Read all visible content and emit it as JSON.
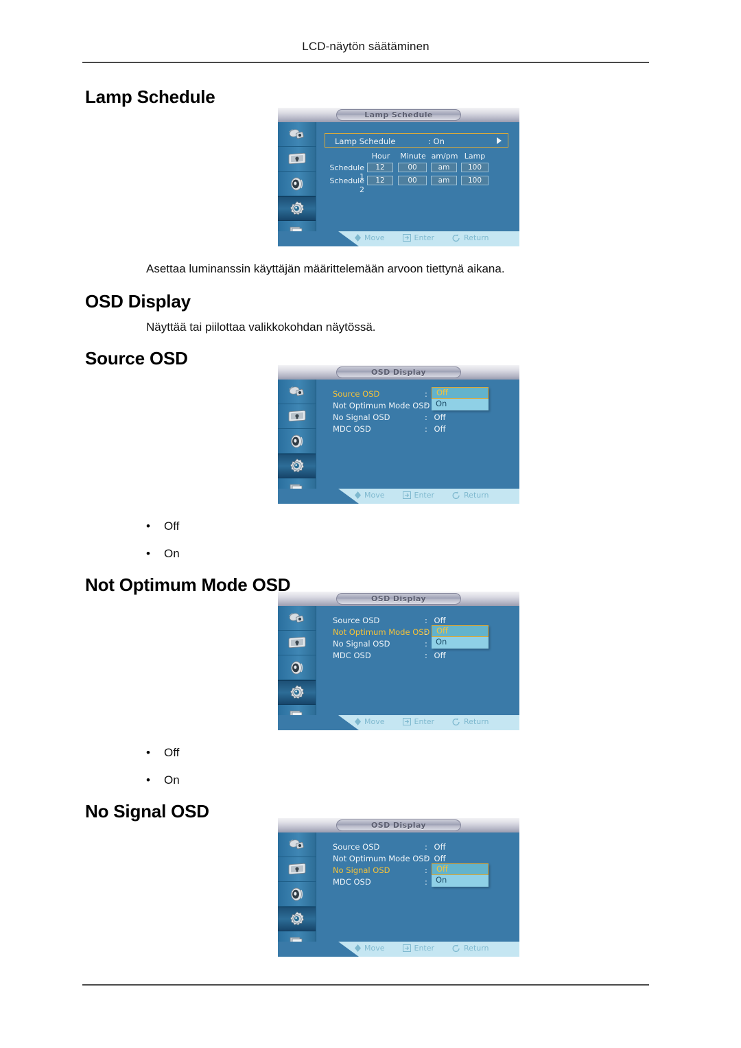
{
  "page": {
    "running_header": "LCD-näytön säätäminen"
  },
  "sections": [
    {
      "heading": "Lamp Schedule",
      "body": "Asettaa luminanssin käyttäjän määrittelemään arvoon tiettynä aikana."
    },
    {
      "heading": "OSD Display",
      "body": "Näyttää tai piilottaa valikkokohdan näytössä."
    },
    {
      "heading": "Source OSD"
    },
    {
      "heading": "Not Optimum Mode OSD"
    },
    {
      "heading": "No Signal OSD"
    }
  ],
  "bullets": {
    "off": "Off",
    "on": "On",
    "marker": "•"
  },
  "osd_common": {
    "footer": {
      "move": "Move",
      "enter": "Enter",
      "return": "Return"
    },
    "sidebar_icons": [
      "input-source-icon",
      "picture-icon",
      "sound-icon",
      "setup-gear-icon",
      "multi-control-icon"
    ],
    "colors": {
      "panel_bg": "#3a7aa8",
      "sidebar_bg": "#3f86b4",
      "footer_bg": "#c5e6f2",
      "highlight_text": "#f5c33a",
      "highlight_border": "#d7a93c",
      "dropdown_selected_bg": "#63b3cc",
      "dropdown_item_bg": "#8fd0e6",
      "text": "#eef4f8"
    }
  },
  "osd_lamp_schedule": {
    "title": "Lamp Schedule",
    "main_row": {
      "label": "Lamp Schedule",
      "value": ": On",
      "arrow": "play-arrow-icon"
    },
    "table": {
      "headers": [
        "Hour",
        "Minute",
        "am/pm",
        "Lamp"
      ],
      "rows": [
        {
          "name": "Schedule 1",
          "values": [
            "12",
            "00",
            "am",
            "100"
          ]
        },
        {
          "name": "Schedule 2",
          "values": [
            "12",
            "00",
            "am",
            "100"
          ]
        }
      ]
    }
  },
  "osd_source": {
    "title": "OSD Display",
    "items": [
      {
        "label": "Source OSD",
        "colon": ":",
        "value": "",
        "selected": true
      },
      {
        "label": "Not Optimum Mode OSD",
        "colon": ":",
        "value": "",
        "selected": false
      },
      {
        "label": "No Signal OSD",
        "colon": ":",
        "value": "Off",
        "selected": false
      },
      {
        "label": "MDC OSD",
        "colon": ":",
        "value": "Off",
        "selected": false
      }
    ],
    "dropdown": {
      "highlighted": "Off",
      "other": "On"
    }
  },
  "osd_not_optimum": {
    "title": "OSD Display",
    "items": [
      {
        "label": "Source OSD",
        "colon": ":",
        "value": "Off",
        "selected": false
      },
      {
        "label": "Not Optimum Mode OSD",
        "colon": ":",
        "value": "",
        "selected": true
      },
      {
        "label": "No Signal OSD",
        "colon": ":",
        "value": "",
        "selected": false
      },
      {
        "label": "MDC OSD",
        "colon": ":",
        "value": "Off",
        "selected": false
      }
    ],
    "dropdown": {
      "highlighted": "Off",
      "other": "On"
    }
  },
  "osd_no_signal": {
    "title": "OSD Display",
    "items": [
      {
        "label": "Source OSD",
        "colon": ":",
        "value": "Off",
        "selected": false
      },
      {
        "label": "Not Optimum Mode OSD",
        "colon": ":",
        "value": "Off",
        "selected": false
      },
      {
        "label": "No Signal OSD",
        "colon": ":",
        "value": "",
        "selected": true
      },
      {
        "label": "MDC OSD",
        "colon": ":",
        "value": "",
        "selected": false
      }
    ],
    "dropdown": {
      "highlighted": "Off",
      "other": "On"
    }
  }
}
